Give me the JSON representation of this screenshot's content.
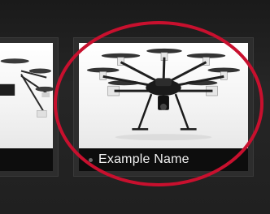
{
  "cards": [
    {
      "name": "",
      "image": "hexacopter-drone"
    },
    {
      "name": "Example Name",
      "image": "hexacopter-drone",
      "status": "offline"
    }
  ],
  "colors": {
    "background": "#1e1e1e",
    "label_bar": "#0d0d0d",
    "label_text": "#f2f2f2",
    "highlight": "#c8102e"
  }
}
